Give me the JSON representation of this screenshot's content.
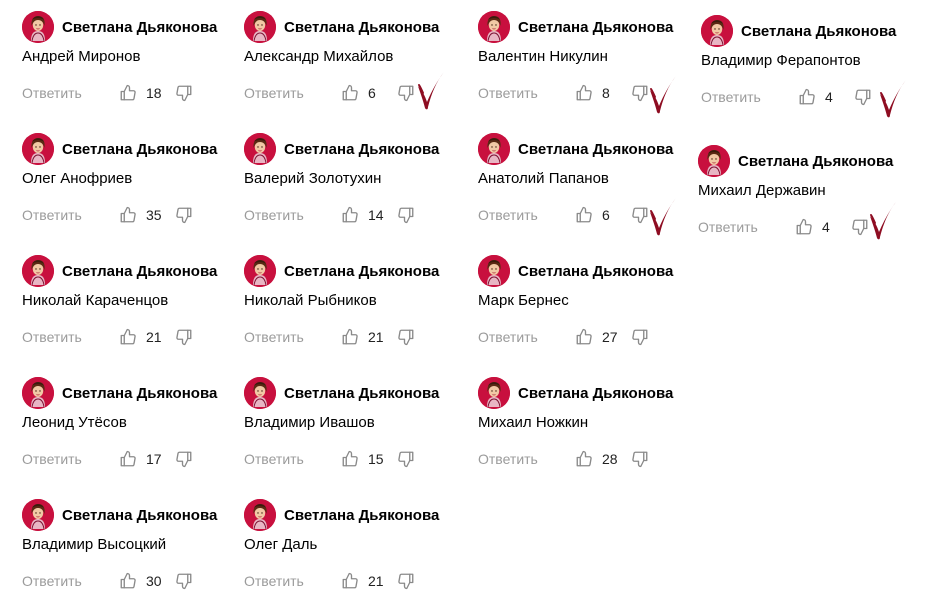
{
  "author_name": "Светлана Дьяконова",
  "reply_label": "Ответить",
  "colors": {
    "avatar_bg": "#c8103e",
    "check_mark": "#8e0d22",
    "muted": "#9b9b9b"
  },
  "icons": [
    "like-icon",
    "dislike-icon",
    "check-mark-icon"
  ],
  "comments": [
    {
      "text": "Андрей Миронов",
      "likes": "18"
    },
    {
      "text": "Александр Михайлов",
      "likes": "6"
    },
    {
      "text": "Валентин Никулин",
      "likes": "8"
    },
    {
      "text": "Владимир Ферапонтов",
      "likes": "4"
    },
    {
      "text": "Олег Анофриев",
      "likes": "35"
    },
    {
      "text": "Валерий Золотухин",
      "likes": "14"
    },
    {
      "text": "Анатолий Папанов",
      "likes": "6"
    },
    {
      "text": "Михаил Державин",
      "likes": "4"
    },
    {
      "text": "Николай Караченцов",
      "likes": "21"
    },
    {
      "text": "Николай Рыбников",
      "likes": "21"
    },
    {
      "text": "Марк Бернес",
      "likes": "27"
    },
    {
      "text": "Леонид Утёсов",
      "likes": "17"
    },
    {
      "text": "Владимир Ивашов",
      "likes": "15"
    },
    {
      "text": "Михаил Ножкин",
      "likes": "28"
    },
    {
      "text": "Владимир Высоцкий",
      "likes": "30"
    },
    {
      "text": "Олег Даль",
      "likes": "21"
    }
  ]
}
